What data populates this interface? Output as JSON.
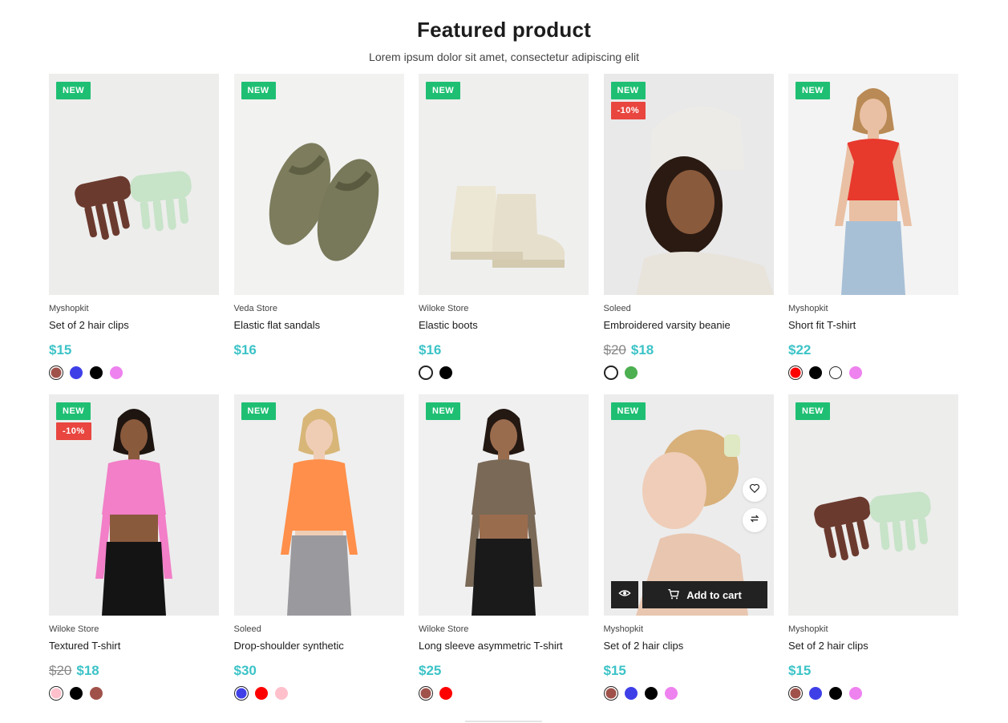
{
  "section": {
    "title": "Featured product",
    "subtitle": "Lorem ipsum dolor sit amet, consectetur adipiscing elit"
  },
  "badges": {
    "new": "NEW"
  },
  "actions": {
    "add_to_cart": "Add to cart"
  },
  "products": [
    {
      "vendor": "Myshopkit",
      "name": "Set of 2 hair clips",
      "price": "$15",
      "old_price": "",
      "badge_sale": "",
      "image": "hair-clips",
      "swatches": [
        "#a0524a",
        "#3f3fe8",
        "#000000",
        "#ee82ee"
      ]
    },
    {
      "vendor": "Veda Store",
      "name": "Elastic flat sandals",
      "price": "$16",
      "old_price": "",
      "badge_sale": "",
      "image": "sandals",
      "swatches": []
    },
    {
      "vendor": "Wiloke Store",
      "name": "Elastic boots",
      "price": "$16",
      "old_price": "",
      "badge_sale": "",
      "image": "boots",
      "swatches": [
        "#ffffff",
        "#000000"
      ]
    },
    {
      "vendor": "Soleed",
      "name": "Embroidered varsity beanie",
      "price": "$18",
      "old_price": "$20",
      "badge_sale": "-10%",
      "image": "beanie",
      "swatches": [
        "#ffffff",
        "#4caf50"
      ]
    },
    {
      "vendor": "Myshopkit",
      "name": "Short fit T-shirt",
      "price": "$22",
      "old_price": "",
      "badge_sale": "",
      "image": "red-tshirt",
      "swatches": [
        "#ff0000",
        "#000000",
        "#ffffff",
        "#ee82ee"
      ]
    },
    {
      "vendor": "Wiloke Store",
      "name": "Textured T-shirt",
      "price": "$18",
      "old_price": "$20",
      "badge_sale": "-10%",
      "image": "pink-top",
      "swatches": [
        "#ffc0cb",
        "#000000",
        "#a0524a"
      ]
    },
    {
      "vendor": "Soleed",
      "name": "Drop-shoulder synthetic",
      "price": "$30",
      "old_price": "",
      "badge_sale": "",
      "image": "orange-cardigan",
      "swatches": [
        "#3f3fe8",
        "#ff0000",
        "#ffc0cb"
      ]
    },
    {
      "vendor": "Wiloke Store",
      "name": "Long sleeve asymmetric T-shirt",
      "price": "$25",
      "old_price": "",
      "badge_sale": "",
      "image": "brown-top",
      "swatches": [
        "#a0524a",
        "#ff0000"
      ]
    },
    {
      "vendor": "Myshopkit",
      "name": "Set of 2 hair clips",
      "price": "$15",
      "old_price": "",
      "badge_sale": "",
      "image": "hair-clip-model",
      "hovered": true,
      "swatches": [
        "#a0524a",
        "#3f3fe8",
        "#000000",
        "#ee82ee"
      ]
    },
    {
      "vendor": "Myshopkit",
      "name": "Set of 2 hair clips",
      "price": "$15",
      "old_price": "",
      "badge_sale": "",
      "image": "hair-clips",
      "swatches": [
        "#a0524a",
        "#3f3fe8",
        "#000000",
        "#ee82ee"
      ]
    }
  ]
}
